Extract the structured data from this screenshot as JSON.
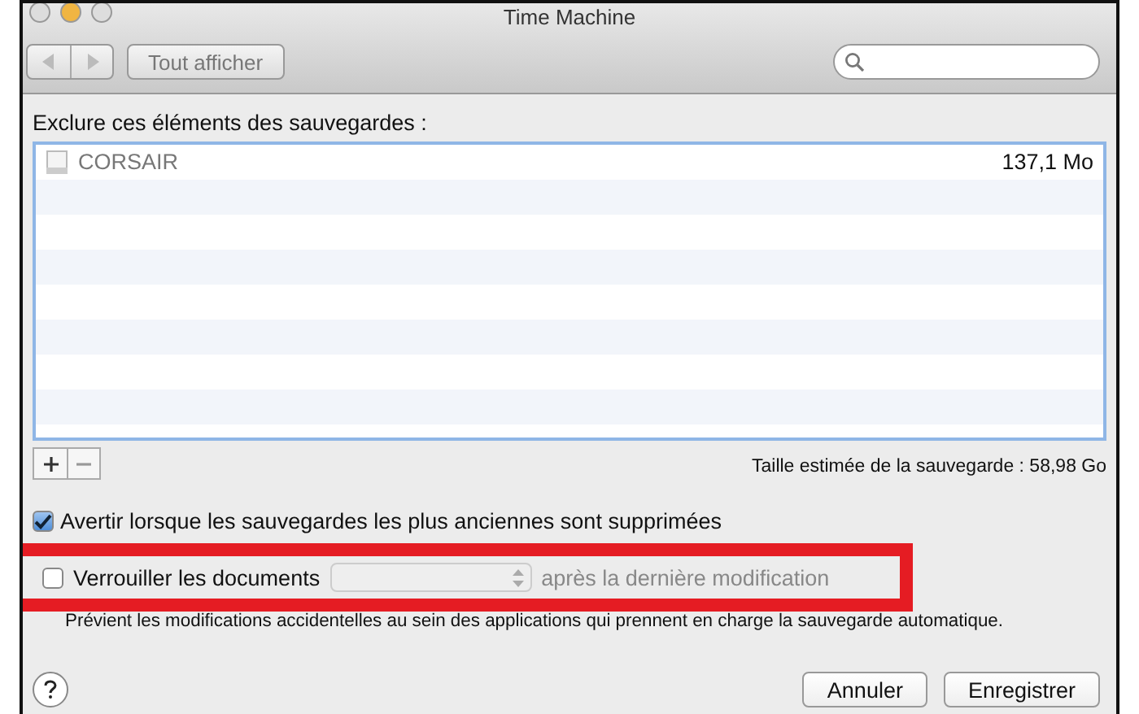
{
  "window": {
    "title": "Time Machine"
  },
  "toolbar": {
    "show_all_button": "Tout afficher"
  },
  "exclusions": {
    "label": "Exclure ces éléments des sauvegardes :",
    "rows": [
      {
        "name": "CORSAIR",
        "size": "137,1 Mo",
        "selected": false
      }
    ],
    "estimated_size": "Taille estimée de la sauvegarde : 58,98 Go"
  },
  "options": [
    {
      "kind": "checkbox",
      "label": "Avertir lorsque les sauvegardes les plus anciennes sont supprimées",
      "checked": true
    },
    {
      "kind": "lock",
      "label": "Verrouiller les documents",
      "suffix": "après la dernière modification",
      "checked": false,
      "disabled": true,
      "highlighted": true,
      "description": "Prévient les modifications accidentelles au sein des applications qui prennent en charge la sauvegarde automatique."
    }
  ],
  "buttons": [
    {
      "label": "Annuler",
      "default": false
    },
    {
      "label": "Enregistrer",
      "default": false
    }
  ]
}
